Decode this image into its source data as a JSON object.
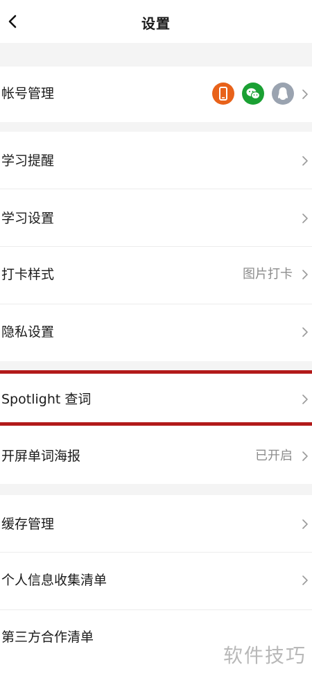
{
  "header": {
    "title": "设置",
    "back_icon": "chevron-left-icon"
  },
  "account": {
    "label": "帐号管理",
    "linked_icons": [
      {
        "name": "phone-icon",
        "color": "#e8621a"
      },
      {
        "name": "wechat-icon",
        "color": "#1aa033"
      },
      {
        "name": "qq-icon",
        "color": "#9aa3b0"
      }
    ]
  },
  "rows": {
    "study_reminder": {
      "label": "学习提醒"
    },
    "study_settings": {
      "label": "学习设置"
    },
    "checkin_style": {
      "label": "打卡样式",
      "value": "图片打卡"
    },
    "privacy": {
      "label": "隐私设置"
    },
    "spotlight": {
      "label": "Spotlight 查词"
    },
    "splash_poster": {
      "label": "开屏单词海报",
      "value": "已开启"
    },
    "cache": {
      "label": "缓存管理"
    },
    "personal_info": {
      "label": "个人信息收集清单"
    },
    "third_party": {
      "label": "第三方合作清单"
    }
  },
  "watermark": "软件技巧",
  "colors": {
    "highlight": "#b21a1a",
    "gap": "#f4f4f4",
    "secondary_text": "#8c8c8c"
  }
}
